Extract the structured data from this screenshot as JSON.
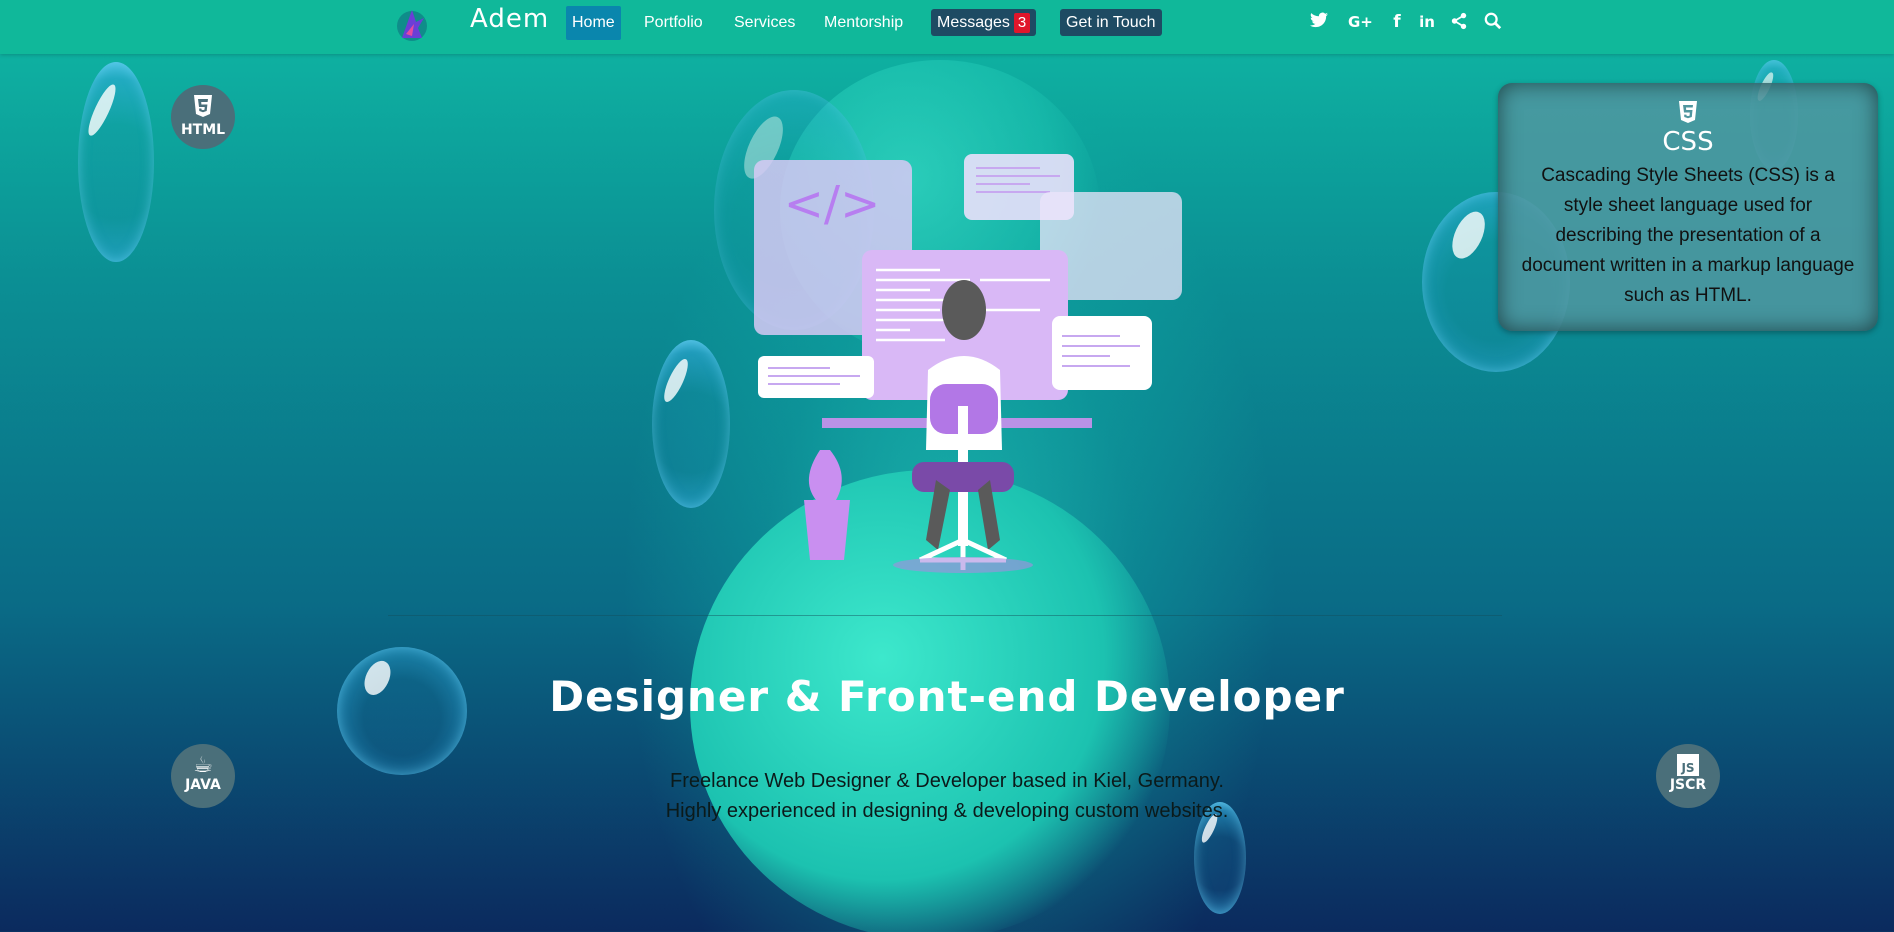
{
  "nav": {
    "brand": "Adem",
    "items": [
      "Home",
      "Portfolio",
      "Services",
      "Mentorship"
    ],
    "messages_label": "Messages",
    "messages_count": "3",
    "contact_label": "Get in Touch",
    "social_icons": [
      "twitter-icon",
      "google-plus-icon",
      "facebook-icon",
      "linkedin-icon",
      "share-icon",
      "search-icon"
    ]
  },
  "skills": {
    "html": {
      "label": "HTML",
      "icon": "html5-icon"
    },
    "java": {
      "label": "JAVA",
      "icon": "java-icon"
    },
    "js": {
      "label": "JS",
      "label_cut": "JSCR",
      "icon": "javascript-icon"
    }
  },
  "css_card": {
    "title": "CSS",
    "icon": "css3-icon",
    "description": "Cascading Style Sheets (CSS) is a style sheet language used for describing the presentation of a document written in a markup language such as HTML."
  },
  "hero": {
    "title": "Designer & Front-end Developer",
    "subtitle_line1": "Freelance Web Designer & Developer based in Kiel, Germany.",
    "subtitle_line2": "Highly experienced in designing & developing custom websites.",
    "illustration_code": "</>"
  },
  "colors": {
    "navbar": "#10b89a",
    "active_nav": "#0a86ad",
    "badge": "#e0162b",
    "accent_purple": "#b77ef0"
  }
}
